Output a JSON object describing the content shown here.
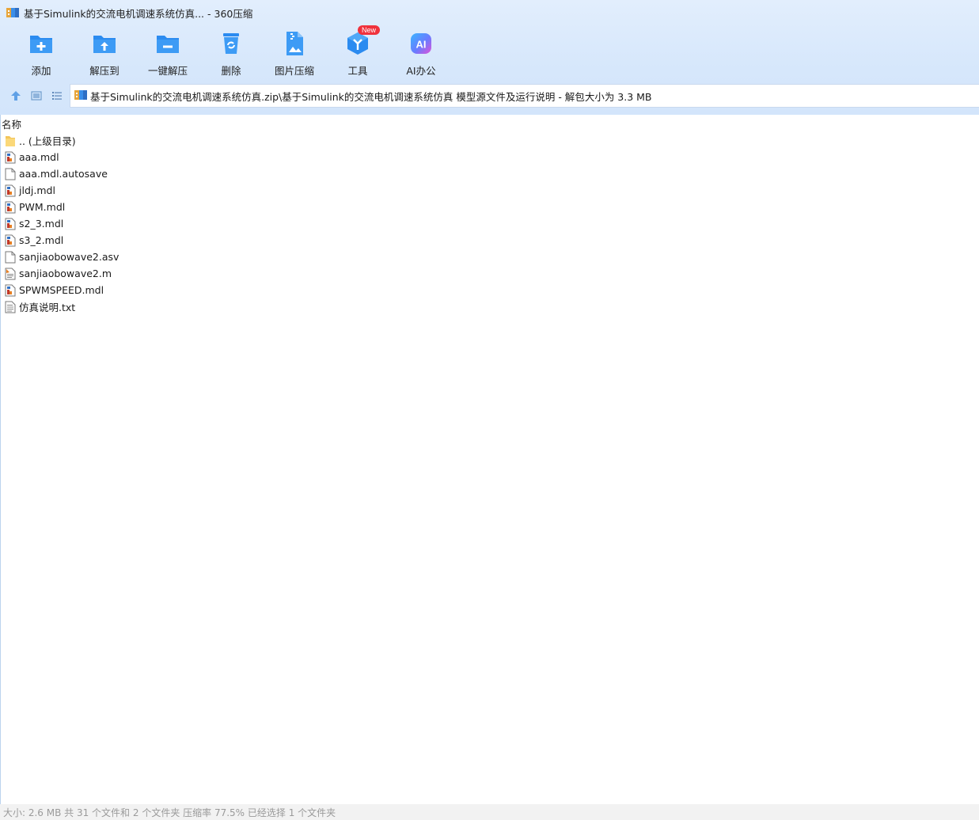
{
  "window": {
    "title": "基于Simulink的交流电机调速系统仿真... - 360压缩",
    "icon": "archive-app-icon"
  },
  "toolbar": {
    "items": [
      {
        "label": "添加",
        "icon": "add-folder-icon"
      },
      {
        "label": "解压到",
        "icon": "extract-to-folder-icon"
      },
      {
        "label": "一键解压",
        "icon": "one-click-extract-icon"
      },
      {
        "label": "删除",
        "icon": "recycle-bin-icon"
      },
      {
        "label": "图片压缩",
        "icon": "image-compress-icon"
      },
      {
        "label": "工具",
        "icon": "tools-cube-icon",
        "badge": "New"
      },
      {
        "label": "AI办公",
        "icon": "ai-office-icon"
      }
    ]
  },
  "navbar": {
    "path": "基于Simulink的交流电机调速系统仿真.zip\\基于Simulink的交流电机调速系统仿真 模型源文件及运行说明 - 解包大小为 3.3 MB"
  },
  "file_list": {
    "column_name": "名称",
    "rows": [
      {
        "name": ".. (上级目录)",
        "icon": "folder-icon"
      },
      {
        "name": "aaa.mdl",
        "icon": "mdl-file-icon"
      },
      {
        "name": "aaa.mdl.autosave",
        "icon": "blank-file-icon"
      },
      {
        "name": "jldj.mdl",
        "icon": "mdl-file-icon"
      },
      {
        "name": "PWM.mdl",
        "icon": "mdl-file-icon"
      },
      {
        "name": "s2_3.mdl",
        "icon": "mdl-file-icon"
      },
      {
        "name": "s3_2.mdl",
        "icon": "mdl-file-icon"
      },
      {
        "name": "sanjiaobowave2.asv",
        "icon": "blank-file-icon"
      },
      {
        "name": "sanjiaobowave2.m",
        "icon": "m-file-icon"
      },
      {
        "name": "SPWMSPEED.mdl",
        "icon": "mdl-file-icon"
      },
      {
        "name": "仿真说明.txt",
        "icon": "text-file-icon"
      }
    ]
  },
  "status": {
    "text": "大小: 2.6 MB 共 31 个文件和 2 个文件夹 压缩率 77.5% 已经选择 1 个文件夹"
  },
  "colors": {
    "accent": "#2b8bf0",
    "header_bg": "#d6e7fb",
    "status_text": "#9a9a9a",
    "badge": "#f0323c"
  }
}
